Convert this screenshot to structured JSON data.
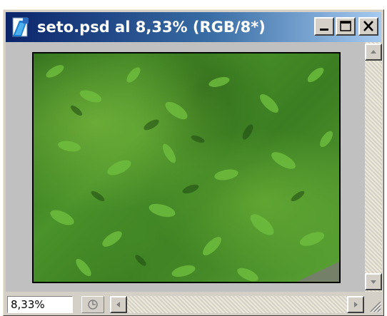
{
  "window": {
    "title": "seto.psd al 8,33% (RGB/8*)",
    "title_icon": "photoshop-document-icon",
    "controls": {
      "minimize_icon": "minimize-icon",
      "maximize_icon": "maximize-icon",
      "close_icon": "close-icon"
    }
  },
  "canvas": {
    "image_description": "hedge foliage photo"
  },
  "statusbar": {
    "zoom_value": "8,33%",
    "status_menu_icon": "status-menu-icon"
  },
  "colors": {
    "titlebar_start": "#0a246a",
    "titlebar_end": "#a6caf0",
    "chrome": "#d4d0c8",
    "workspace": "#c0c0c0"
  }
}
